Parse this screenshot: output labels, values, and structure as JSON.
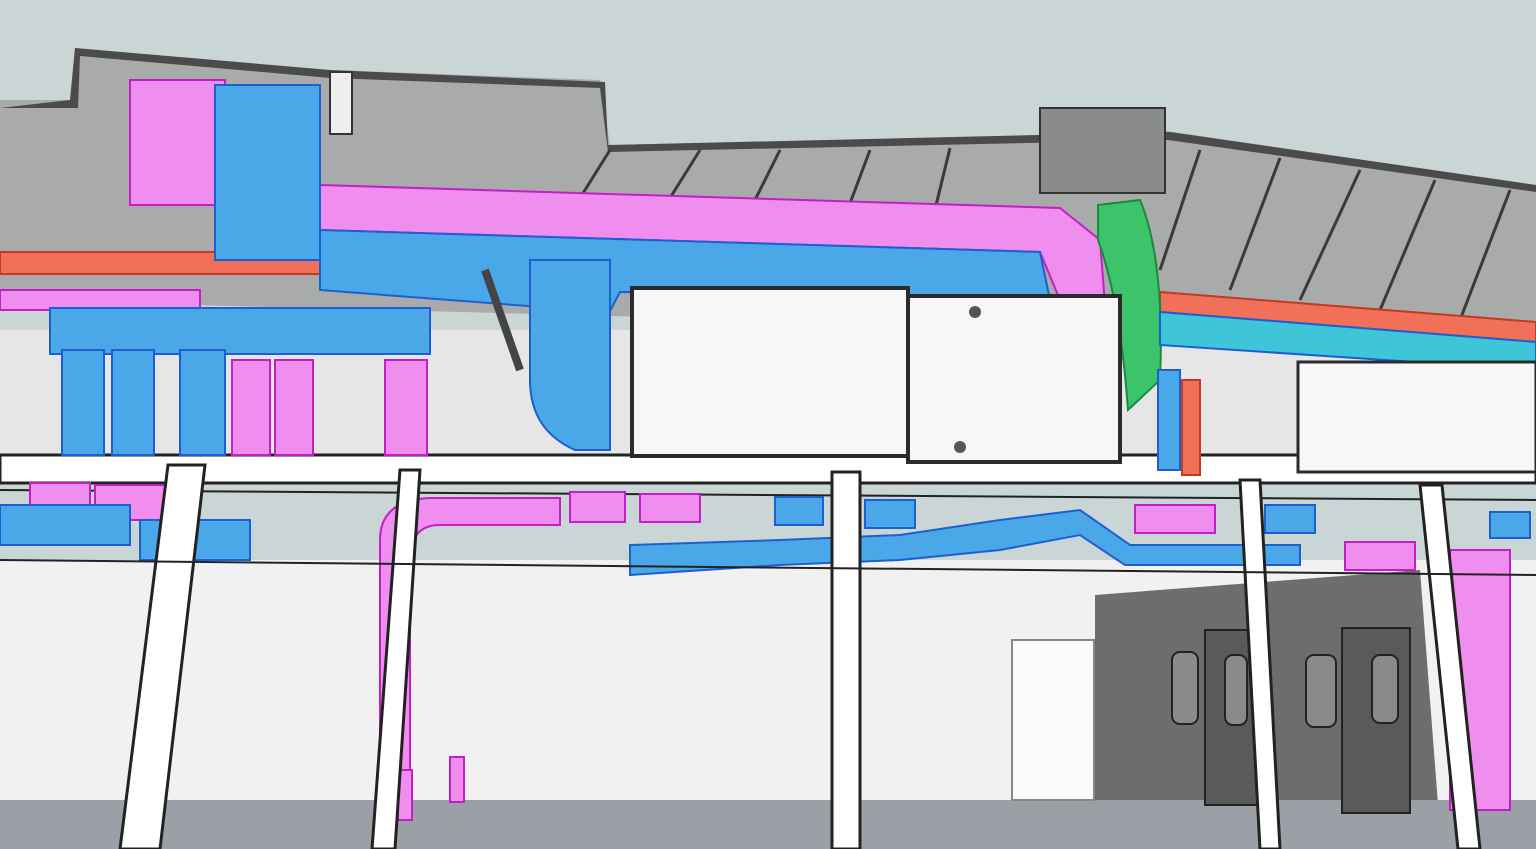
{
  "colors": {
    "sky": "#c9d6d5",
    "roof_underside": "#9a9c9c",
    "roof_edge": "#2a2a2a",
    "wall_white": "#f4f4f4",
    "wall_grey": "#d8d8d8",
    "floor": "#9aa0a6",
    "supply_duct": "#4aa8e8",
    "supply_duct_dark": "#1d5fd0",
    "return_duct": "#f08ef0",
    "return_duct_dark": "#c21fc9",
    "exhaust_duct": "#3cc46a",
    "hot_pipe": "#f0705a",
    "cyan_duct": "#3ec6d8",
    "air_handler": "#f7f7f7",
    "dark_room": "#6f6f6f",
    "door": "#5a5a5a"
  },
  "icons": [
    "air-handling-unit-icon",
    "door-icon",
    "column-icon"
  ]
}
